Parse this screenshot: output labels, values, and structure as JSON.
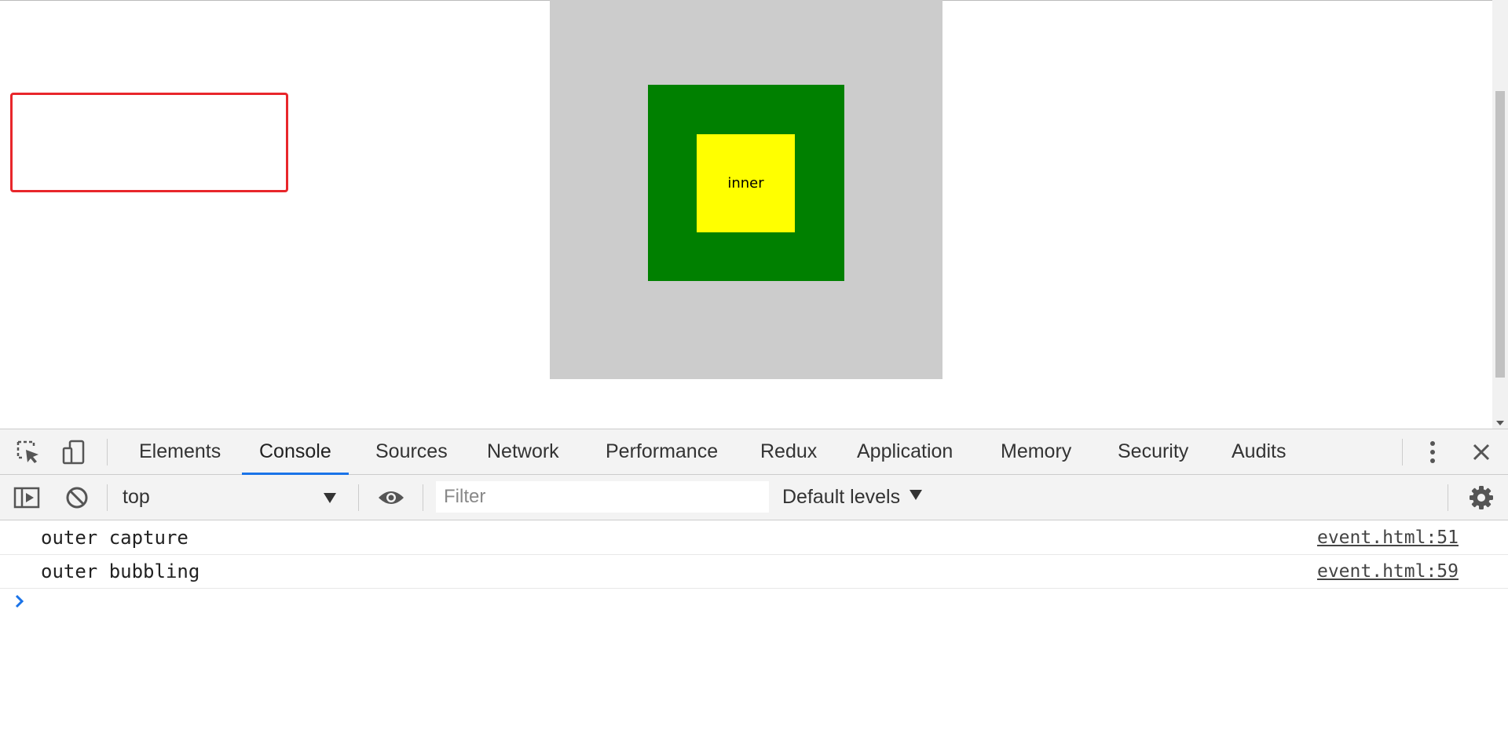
{
  "page": {
    "inner_label": "inner",
    "colors": {
      "outer": "#cccccc",
      "middle": "#008000",
      "inner": "#ffff00"
    }
  },
  "devtools": {
    "tabs": [
      {
        "label": "Elements",
        "active": false
      },
      {
        "label": "Console",
        "active": true
      },
      {
        "label": "Sources",
        "active": false
      },
      {
        "label": "Network",
        "active": false
      },
      {
        "label": "Performance",
        "active": false
      },
      {
        "label": "Redux",
        "active": false
      },
      {
        "label": "Application",
        "active": false
      },
      {
        "label": "Memory",
        "active": false
      },
      {
        "label": "Security",
        "active": false
      },
      {
        "label": "Audits",
        "active": false
      }
    ],
    "accent_color": "#1a73e8",
    "icons": [
      "inspect-element-icon",
      "device-toolbar-icon",
      "more-options-icon",
      "close-icon"
    ]
  },
  "console_toolbar": {
    "context": "top",
    "filter_placeholder": "Filter",
    "levels_label": "Default levels",
    "icons": [
      "show-sidebar-icon",
      "clear-console-icon",
      "live-expression-eye-icon",
      "settings-gear-icon"
    ]
  },
  "console": {
    "messages": [
      {
        "text": "outer capture",
        "source": "event.html:51"
      },
      {
        "text": "outer bubbling",
        "source": "event.html:59"
      }
    ],
    "highlight_color": "#e8262b"
  }
}
